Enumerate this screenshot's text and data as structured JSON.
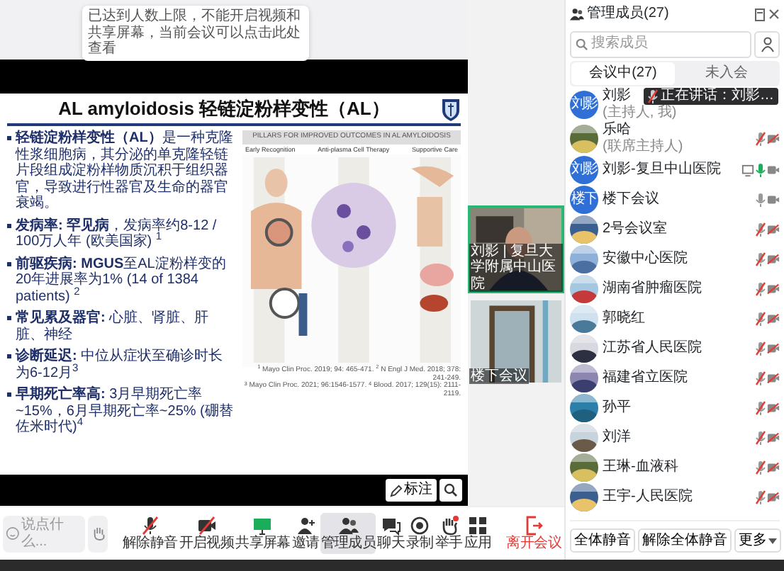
{
  "share_notice": "已达到人数上限，不能开启视频和共享屏幕，当前会议可以点击此处查看",
  "slide": {
    "title": "AL amyloidosis 轻链淀粉样变性（AL）",
    "bullets": [
      "**轻链淀粉样变性（AL）**是一种克隆性浆细胞病，其分泌的单克隆轻链片段组成淀粉样物质沉积于组织器官，导致进行性器官及生命的器官衰竭。",
      "**发病率: 罕见病**，发病率约8-12 / 100万人年 (欧美国家) $^{1}$",
      "**前驱疾病: MGUS**至AL淀粉样变的20年进展率为1% (14 of 1384 patients) $^{2}$",
      "**常见累及器官:** 心脏、肾脏、肝脏、神经",
      "**诊断延迟:** 中位从症状至确诊时长为6-12月$^{3}$",
      "**早期死亡率高:** 3月早期死亡率~15%，6月早期死亡率~25% (硼替佐米时代)$^{4}$"
    ],
    "figure_title": "PILLARS FOR IMPROVED OUTCOMES IN AL AMYLOIDOSIS",
    "figure_columns": [
      "Early Recognition",
      "Anti-plasma Cell Therapy",
      "Supportive Care"
    ],
    "references": [
      "$^{1}$ Mayo Clin Proc. 2019; 94: 465-471. $^{2}$ N Engl J Med. 2018; 378: 241-249.",
      "$^{3}$ Mayo Clin Proc. 2021; 96:1546-1577. $^{4}$ Blood. 2017; 129(15): 2111-2119."
    ]
  },
  "annotate_button": "标注",
  "videos": [
    {
      "label": "刘影 | 复旦大学附属中山医院",
      "highlighted": true
    },
    {
      "label": "楼下会议",
      "highlighted": false
    }
  ],
  "toolbar": {
    "chat_placeholder": "说点什么...",
    "items": [
      {
        "label": "解除静音",
        "slashed": true,
        "selected": false
      },
      {
        "label": "开启视频",
        "slashed": true,
        "selected": false
      },
      {
        "label": "共享屏幕",
        "slashed": false,
        "selected": false
      },
      {
        "label": "邀请",
        "slashed": false,
        "selected": false
      },
      {
        "label": "管理成员",
        "slashed": false,
        "selected": true
      },
      {
        "label": "聊天",
        "slashed": false,
        "selected": false
      },
      {
        "label": "录制",
        "slashed": false,
        "selected": false
      },
      {
        "label": "举手",
        "slashed": false,
        "selected": false
      },
      {
        "label": "应用",
        "slashed": false,
        "selected": false
      }
    ],
    "leave": "离开会议"
  },
  "panel": {
    "title": "管理成员(27)",
    "search_placeholder": "搜索成员",
    "tabs": [
      {
        "label": "会议中(27)",
        "selected": true
      },
      {
        "label": "未入会",
        "selected": false
      }
    ],
    "speaking_tooltip": "正在讲话：刘影…",
    "participants": [
      {
        "name": "刘影",
        "role": "(主持人, 我)",
        "avatar": {
          "kind": "initials",
          "text": "刘影"
        }
      },
      {
        "name": "乐哈",
        "role": "(联席主持人)",
        "muted": true,
        "speaking": false,
        "camera_on": false,
        "sharing": false
      },
      {
        "name": "刘影-复旦中山医院",
        "avatar": {
          "kind": "initials",
          "text": "刘影"
        },
        "muted": false,
        "speaking": true,
        "camera_on": true,
        "sharing": true
      },
      {
        "name": "楼下会议",
        "avatar": {
          "kind": "initials",
          "text": "楼下"
        },
        "muted": false,
        "speaking": false,
        "camera_on": true,
        "sharing": false
      },
      {
        "name": "2号会议室",
        "muted": true,
        "speaking": false,
        "camera_on": false,
        "sharing": false
      },
      {
        "name": "安徽中心医院",
        "muted": true,
        "speaking": false,
        "camera_on": false,
        "sharing": false
      },
      {
        "name": "湖南省肿瘤医院",
        "muted": true,
        "speaking": false,
        "camera_on": false,
        "sharing": false
      },
      {
        "name": "郭晓红",
        "muted": true,
        "speaking": false,
        "camera_on": false,
        "sharing": false
      },
      {
        "name": "江苏省人民医院",
        "muted": true,
        "speaking": false,
        "camera_on": false,
        "sharing": false
      },
      {
        "name": "福建省立医院",
        "muted": true,
        "speaking": false,
        "camera_on": false,
        "sharing": false
      },
      {
        "name": "孙平",
        "muted": true,
        "speaking": false,
        "camera_on": false,
        "sharing": false
      },
      {
        "name": "刘洋",
        "muted": true,
        "speaking": false,
        "camera_on": false,
        "sharing": false
      },
      {
        "name": "王琳-血液科",
        "muted": true,
        "speaking": false,
        "camera_on": false,
        "sharing": false
      },
      {
        "name": "王宇-人民医院",
        "muted": true,
        "speaking": false,
        "camera_on": false,
        "sharing": false
      }
    ],
    "buttons": [
      "全体静音",
      "解除全体静音",
      "更多"
    ]
  }
}
